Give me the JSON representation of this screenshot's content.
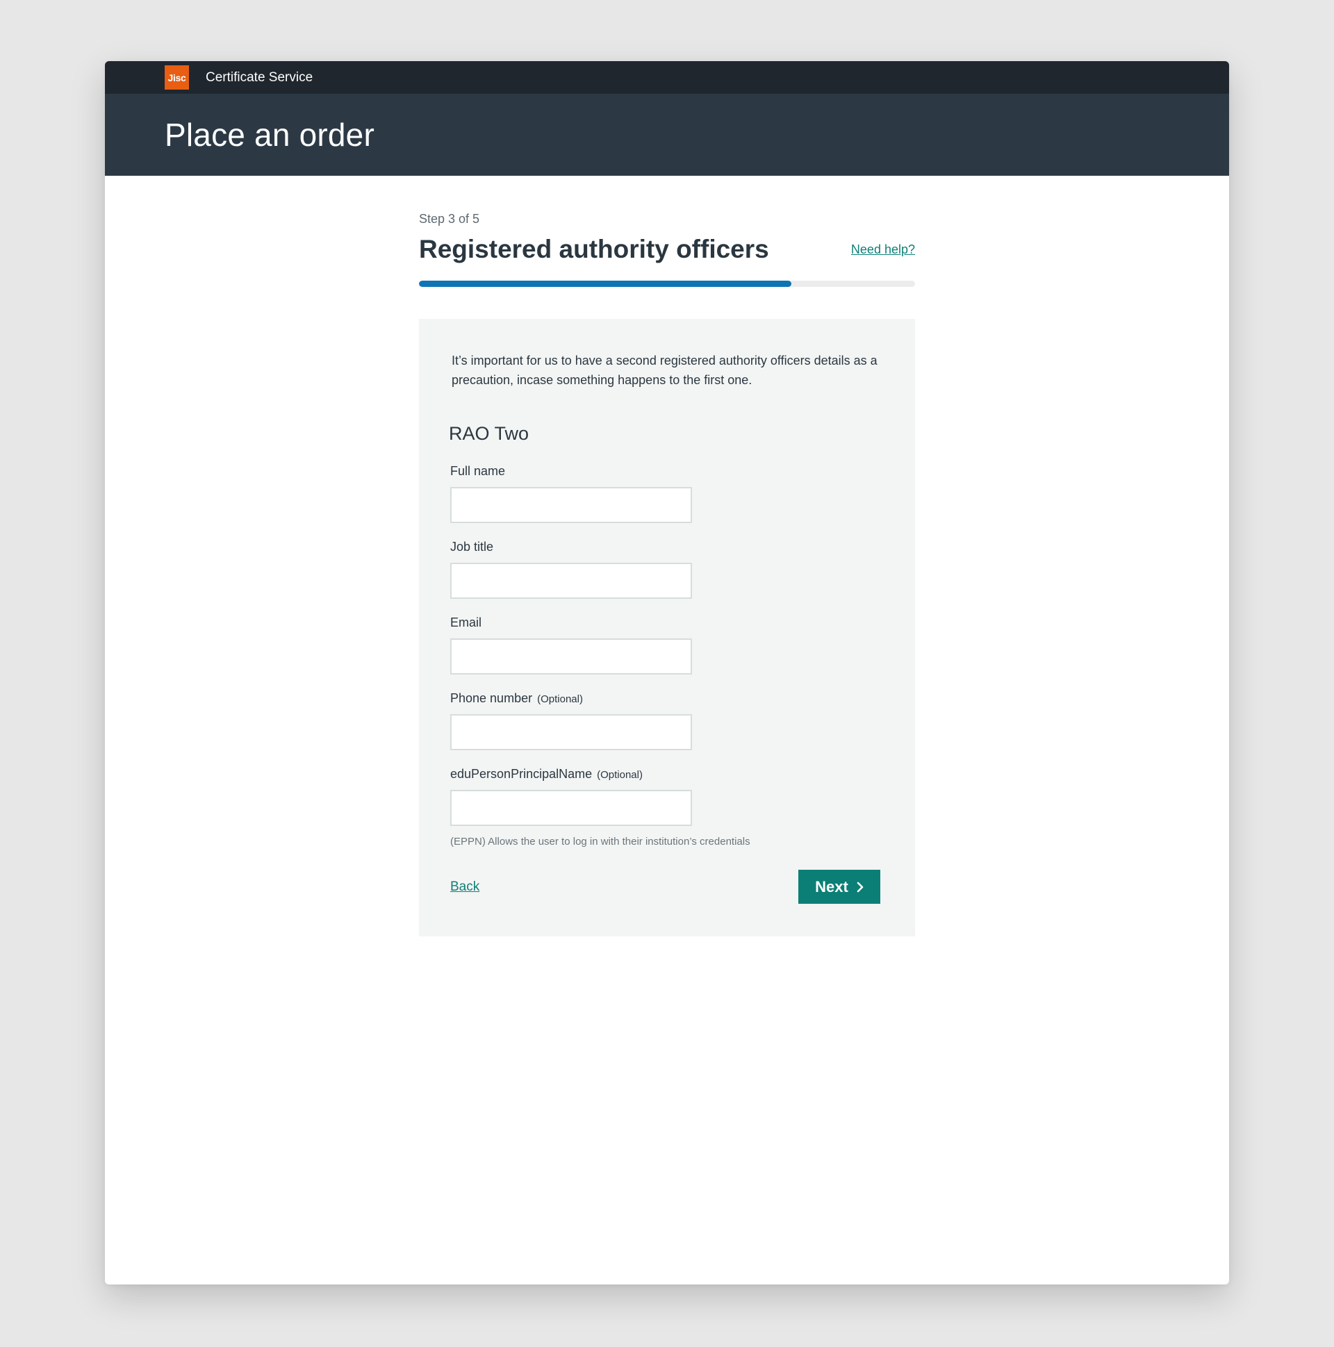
{
  "header": {
    "logo_text": "Jisc",
    "service_name": "Certificate Service",
    "page_title": "Place an order"
  },
  "wizard": {
    "step_label": "Step 3 of 5",
    "title": "Registered authority officers",
    "help_link": "Need help?",
    "progress_fraction": 0.75
  },
  "form": {
    "intro": "It’s important for us to have a second registered authority officers details as a precaution, incase something happens to the first one.",
    "section_heading": "RAO Two",
    "fields": [
      {
        "label": "Full name",
        "optional": "",
        "value": "",
        "placeholder": ""
      },
      {
        "label": "Job title",
        "optional": "",
        "value": "",
        "placeholder": ""
      },
      {
        "label": "Email",
        "optional": "",
        "value": "",
        "placeholder": ""
      },
      {
        "label": "Phone number",
        "optional": "(Optional)",
        "value": "",
        "placeholder": ""
      },
      {
        "label": "eduPersonPrincipalName",
        "optional": "(Optional)",
        "value": "",
        "placeholder": ""
      }
    ],
    "eppn_hint": "(EPPN) Allows the user to log in with their institution’s credentials"
  },
  "actions": {
    "back_label": "Back",
    "next_label": "Next"
  },
  "icons": {
    "next": "chevron-right-icon"
  },
  "colors": {
    "accent": "#0b7f76",
    "progress": "#0f74b4",
    "logo": "#e85e13",
    "header_dark": "#1f262e",
    "hero": "#2c3945"
  }
}
